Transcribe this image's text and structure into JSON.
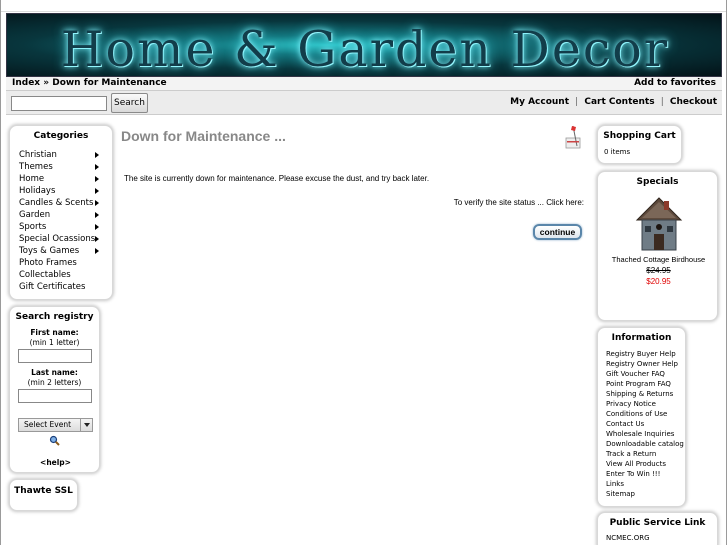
{
  "banner": {
    "title": "Home & Garden Decor"
  },
  "breadcrumb": {
    "index": "Index",
    "sep": "»",
    "current": "Down for Maintenance"
  },
  "header": {
    "add_favorites": "Add to favorites"
  },
  "search": {
    "button": "Search",
    "value": ""
  },
  "account": {
    "my_account": "My Account",
    "cart_contents": "Cart Contents",
    "checkout": "Checkout",
    "sep": "|"
  },
  "categories": {
    "title": "Categories",
    "items": [
      {
        "label": "Christian",
        "has_sub": true
      },
      {
        "label": "Themes",
        "has_sub": true
      },
      {
        "label": "Home",
        "has_sub": true
      },
      {
        "label": "Holidays",
        "has_sub": true
      },
      {
        "label": "Candles & Scents",
        "has_sub": true
      },
      {
        "label": "Garden",
        "has_sub": true
      },
      {
        "label": "Sports",
        "has_sub": true
      },
      {
        "label": "Special Ocassions",
        "has_sub": true
      },
      {
        "label": "Toys & Games",
        "has_sub": true
      },
      {
        "label": "Photo Frames",
        "has_sub": false
      },
      {
        "label": "Collectables",
        "has_sub": false
      },
      {
        "label": "Gift Certificates",
        "has_sub": false
      }
    ]
  },
  "registry": {
    "title": "Search registry",
    "first_name_label": "First name:",
    "first_name_hint": "(min 1 letter)",
    "last_name_label": "Last name:",
    "last_name_hint": "(min 2 letters)",
    "select_event": "Select Event",
    "help": "<help>"
  },
  "thawte": {
    "title": "Thawte SSL"
  },
  "main": {
    "title": "Down for Maintenance ...",
    "message": "The site is currently down for maintenance. Please excuse the dust, and try back later.",
    "verify": "To verify the site status ... Click here:",
    "continue": "continue"
  },
  "cart": {
    "title": "Shopping Cart",
    "items": "0 items"
  },
  "specials": {
    "title": "Specials",
    "product": "Thached Cottage Birdhouse",
    "old_price": "$24.95",
    "new_price": "$20.95"
  },
  "information": {
    "title": "Information",
    "items": [
      "Registry Buyer Help",
      "Registry Owner Help",
      "Gift Voucher FAQ",
      "Point Program FAQ",
      "Shipping & Returns",
      "Privacy Notice",
      "Conditions of Use",
      "Contact Us",
      "Wholesale Inquiries",
      "Downloadable catalog",
      "Track a Return",
      "View All Products",
      "Enter To Win !!!",
      "Links",
      "Sitemap"
    ]
  },
  "public_service": {
    "title": "Public Service Link",
    "items": [
      "NCMEC.ORG"
    ]
  },
  "colors": {
    "banner_glow": "#4bdfee",
    "sale_price": "#e00000",
    "button_border": "#5a86aa"
  }
}
